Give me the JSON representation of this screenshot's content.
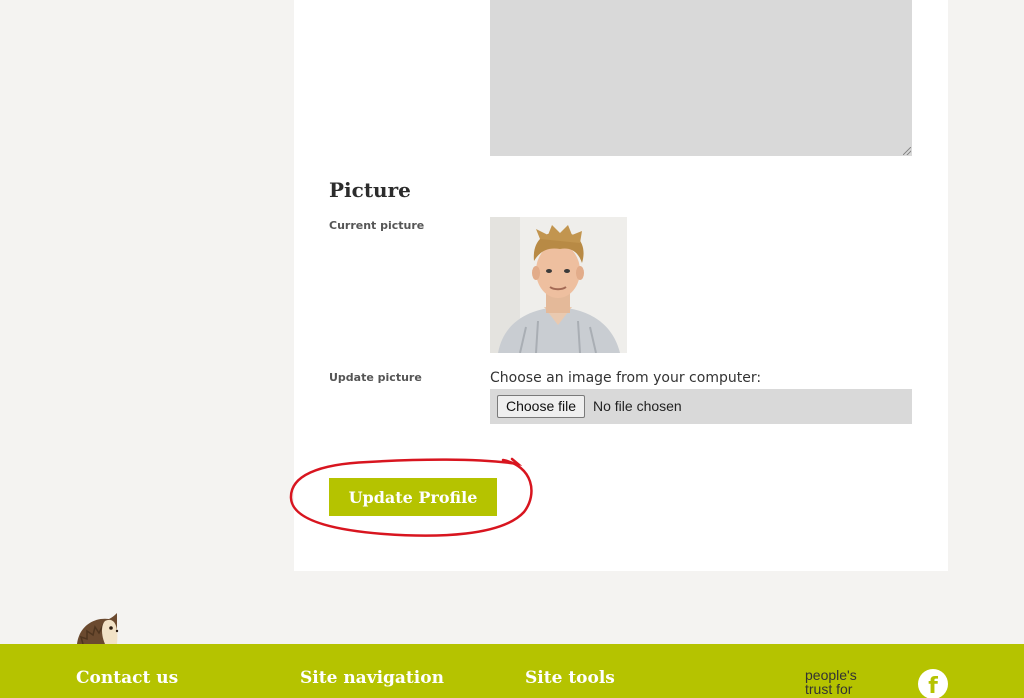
{
  "form": {
    "section_title": "Picture",
    "current_picture_label": "Current picture",
    "update_picture_label": "Update picture",
    "choose_prompt": "Choose an image from your computer:",
    "file_button_label": "Choose file",
    "file_status": "No file chosen",
    "submit_label": "Update Profile"
  },
  "footer": {
    "contact_heading": "Contact us",
    "navigation_heading": "Site navigation",
    "tools_heading": "Site tools",
    "logo_line1": "people's",
    "logo_line2": "trust for",
    "social_icon_glyph": "f"
  },
  "icons": {
    "mascot": "hedgehog-icon",
    "social": "facebook-icon",
    "resize": "resize-grip-icon"
  },
  "colors": {
    "brand_green": "#b5c300",
    "page_background": "#f4f3f1",
    "field_gray": "#d9d9d9",
    "annotation_red": "#d8151f"
  }
}
